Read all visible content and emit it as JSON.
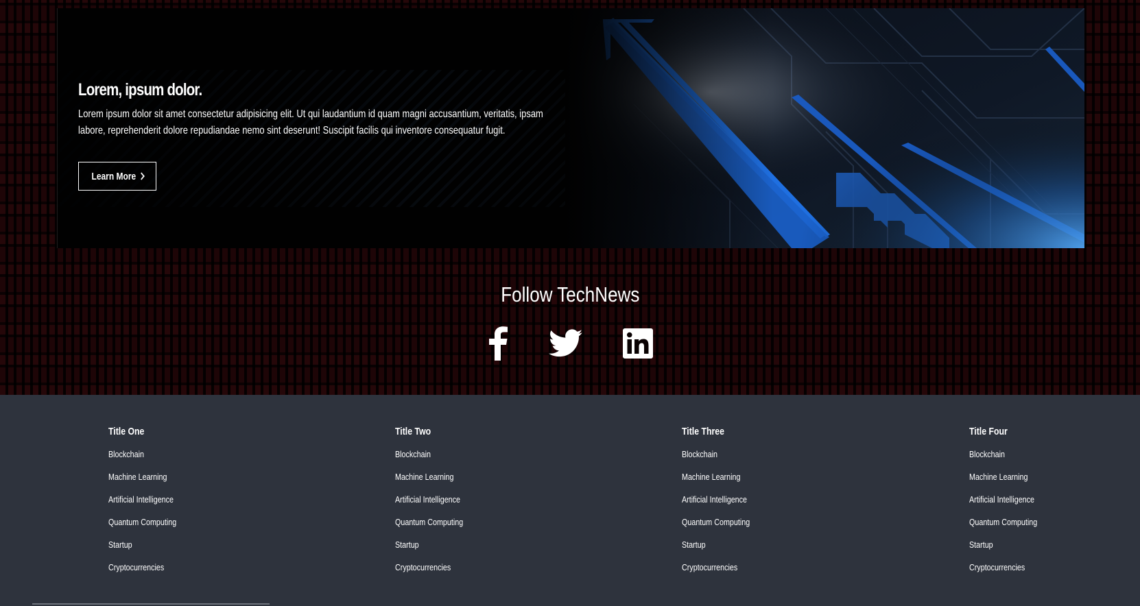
{
  "hero": {
    "title": "Lorem, ipsum dolor.",
    "text": "Lorem ipsum dolor sit amet consectetur adipisicing elit. Ut qui laudantium id quam magni accusantium, veritatis, ipsam labore, reprehenderit dolore repudiandae nemo sint deserunt! Suscipit facilis qui inventore consequatur fugit.",
    "button_label": "Learn More",
    "button_icon": "chevron-right-icon"
  },
  "follow": {
    "title": "Follow TechNews",
    "icons": [
      "facebook-icon",
      "twitter-icon",
      "linkedin-icon"
    ]
  },
  "footer": {
    "columns": [
      {
        "title": "Title One",
        "links": [
          "Blockchain",
          "Machine Learning",
          "Artificial Intelligence",
          "Quantum Computing",
          "Startup",
          "Cryptocurrencies"
        ]
      },
      {
        "title": "Title Two",
        "links": [
          "Blockchain",
          "Machine Learning",
          "Artificial Intelligence",
          "Quantum Computing",
          "Startup",
          "Cryptocurrencies"
        ]
      },
      {
        "title": "Title Three",
        "links": [
          "Blockchain",
          "Machine Learning",
          "Artificial Intelligence",
          "Quantum Computing",
          "Startup",
          "Cryptocurrencies"
        ]
      },
      {
        "title": "Title Four",
        "links": [
          "Blockchain",
          "Machine Learning",
          "Artificial Intelligence",
          "Quantum Computing",
          "Startup",
          "Cryptocurrencies"
        ]
      }
    ]
  },
  "colors": {
    "footer_bg": "#2e333d",
    "accent_blue": "#1f6fe0",
    "background_pattern": "#3a0b0e"
  }
}
